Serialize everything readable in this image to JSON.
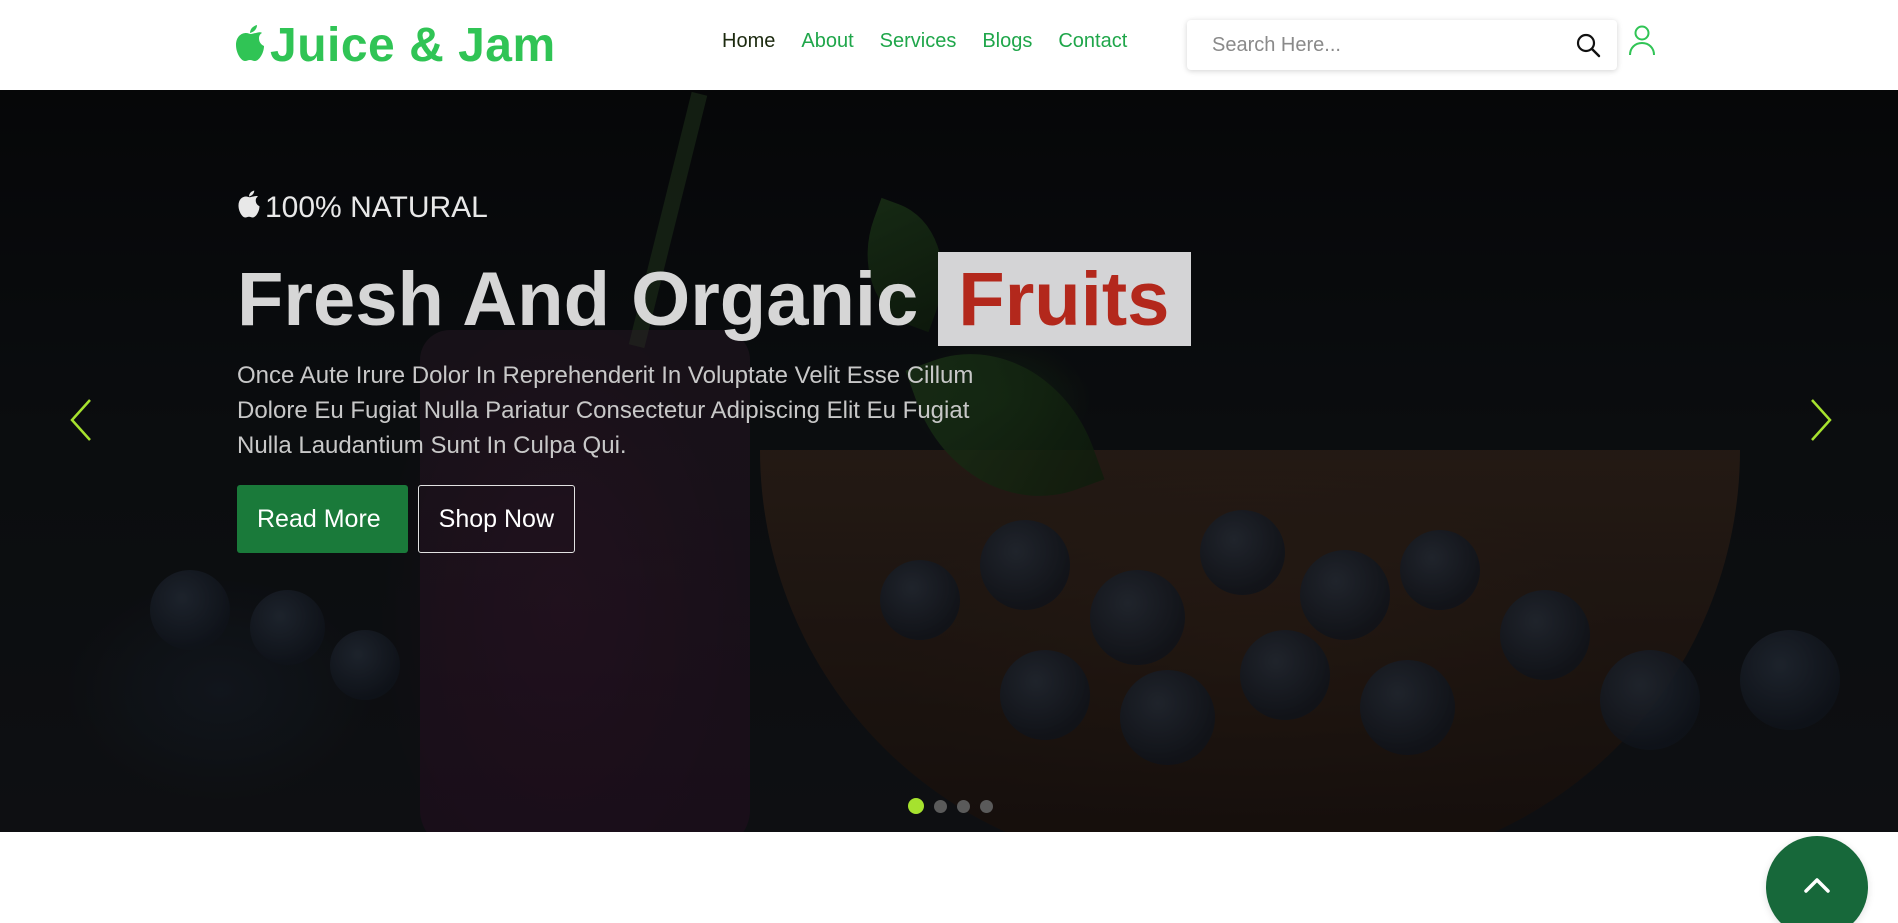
{
  "colors": {
    "brand_green": "#30c455",
    "nav_green": "#1fa64a",
    "nav_active": "#1c2a0f",
    "button_green": "#1a7a3a",
    "highlight_bg": "#d4d4d6",
    "highlight_text": "#b3281c",
    "arrow_color": "#a6e22e",
    "back_to_top_bg": "#17683a"
  },
  "header": {
    "logo_icon": "apple-icon",
    "logo_text": "Juice & Jam",
    "nav": [
      {
        "label": "Home",
        "active": true
      },
      {
        "label": "About",
        "active": false
      },
      {
        "label": "Services",
        "active": false
      },
      {
        "label": "Blogs",
        "active": false
      },
      {
        "label": "Contact",
        "active": false
      }
    ],
    "search": {
      "placeholder": "Search Here...",
      "value": "",
      "icon": "search-icon"
    },
    "user_icon": "user-icon"
  },
  "hero": {
    "kicker_icon": "apple-icon",
    "kicker": "100% NATURAL",
    "headline": "Fresh And Organic",
    "headline_highlight": "Fruits",
    "description": "Once Aute Irure Dolor In Reprehenderit In Voluptate Velit Esse Cillum Dolore Eu Fugiat Nulla Pariatur Consectetur Adipiscing Elit Eu Fugiat Nulla Laudantium Sunt In Culpa Qui.",
    "primary_button": "Read More",
    "secondary_button": "Shop Now",
    "prev_icon": "chevron-left-icon",
    "next_icon": "chevron-right-icon",
    "slides_count": 4,
    "active_slide": 1
  },
  "back_to_top_icon": "chevron-up-icon"
}
